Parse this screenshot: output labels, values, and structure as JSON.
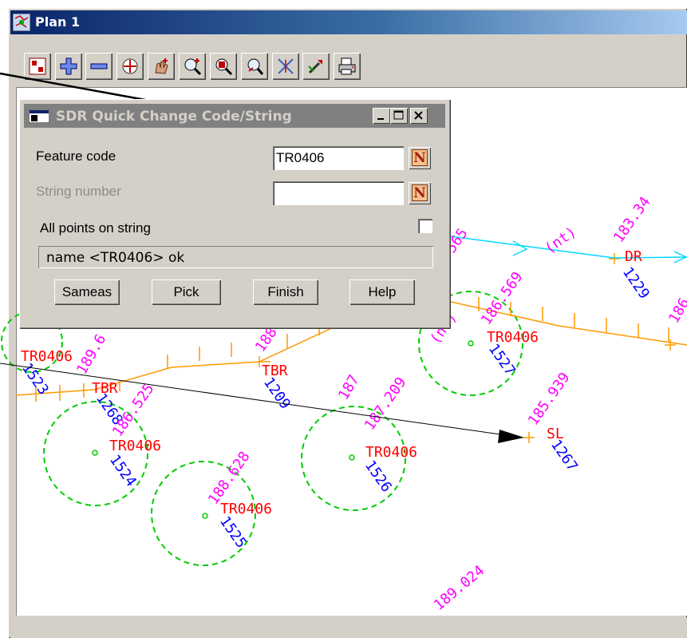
{
  "window": {
    "title": "Plan 1"
  },
  "toolbar": {
    "buttons": [
      "plot-frame-icon",
      "zoom-in-icon",
      "zoom-out-icon",
      "zoom-extent-icon",
      "pan-icon",
      "zoom-scale-icon",
      "zoom-window-icon",
      "zoom-previous-icon",
      "cursor-cross-icon",
      "pick-icon",
      "print-icon"
    ]
  },
  "dialog": {
    "title": "SDR Quick Change Code/String",
    "feature_code_label": "Feature code",
    "feature_code_value": "TR0406",
    "string_number_label": "String number",
    "string_number_value": "",
    "all_points_label": "All points on string",
    "all_points_checked": false,
    "n_button": "N",
    "status": "name <TR0406> ok",
    "buttons": {
      "sameas": "Sameas",
      "pick": "Pick",
      "finish": "Finish",
      "help": "Help"
    }
  },
  "plan": {
    "red_labels": [
      "DR",
      "TR0406",
      "TR0406",
      "TBR",
      "TBR",
      "TR0406",
      "TR0406",
      "TR0406",
      "SL"
    ],
    "blue_labels": [
      "1229",
      "1527",
      "1523",
      "1268",
      "1209",
      "1524",
      "1526",
      "1525",
      "1267"
    ],
    "magenta_labels": [
      "183.34",
      "565",
      "186.569",
      "189.6",
      "188",
      "186.525",
      "187.209",
      "185.939",
      "188.628",
      "189.024",
      "187",
      "186"
    ],
    "annotation_text": [
      "(nt)",
      "(nt)"
    ],
    "colors": {
      "red": "#ff0000",
      "blue": "#0000ff",
      "magenta": "#ff00ff",
      "green": "#00cc00",
      "orange": "#ff9900",
      "cyan": "#00d8ff"
    }
  }
}
